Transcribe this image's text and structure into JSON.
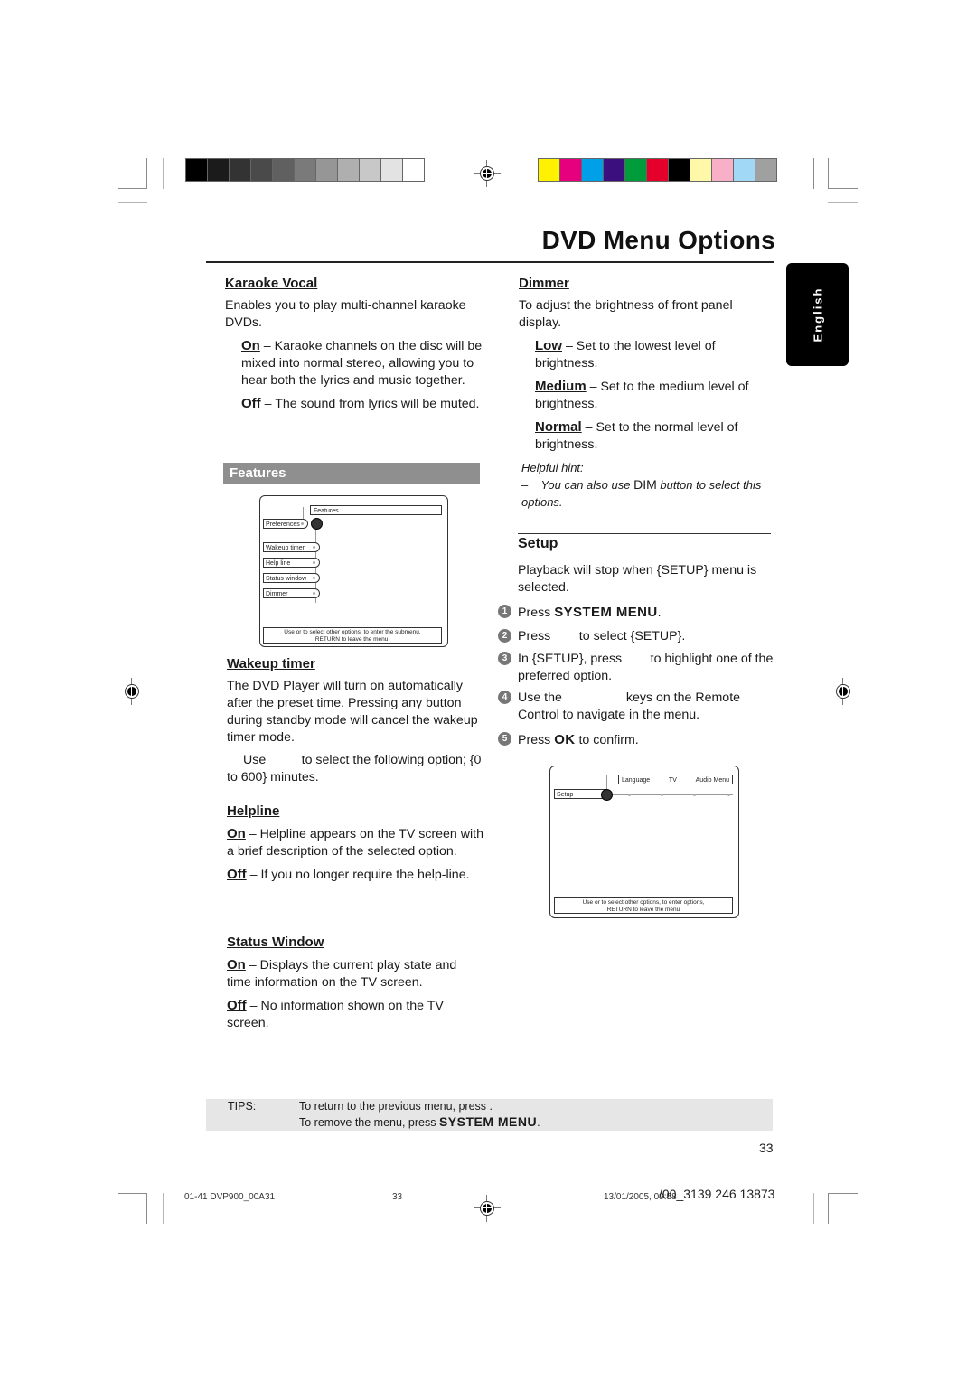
{
  "header": {
    "title": "DVD Menu Options",
    "language_tab": "English"
  },
  "print_marks": {
    "grayscale_swatches": [
      "#000000",
      "#1b1b1b",
      "#333333",
      "#4a4a4a",
      "#606060",
      "#7a7a7a",
      "#969696",
      "#afafaf",
      "#c8c8c8",
      "#e3e3e3",
      "#ffffff"
    ],
    "color_swatches": [
      "#fff200",
      "#e6007e",
      "#00a0e9",
      "#3b0f7e",
      "#009b3a",
      "#e4002b",
      "#000000",
      "#fff8a8",
      "#f8b0c8",
      "#a0d8f5",
      "#a0a0a0"
    ]
  },
  "left_column": {
    "karaoke": {
      "heading": "Karaoke Vocal",
      "intro": "Enables you to play multi-channel karaoke DVDs.",
      "on_label": "On",
      "on_text": " – Karaoke channels on the disc will be mixed into normal stereo, allowing you to hear both the lyrics and music together.",
      "off_label": "Off",
      "off_text": " – The sound from lyrics will be muted."
    },
    "features_bar": "Features",
    "features_menu": {
      "header": "Features",
      "parent": "Preferences",
      "items": [
        "Wakeup timer",
        "Help line",
        "Status window",
        "Dimmer"
      ],
      "footer_line1": "Use    or    to select other options, to enter the submenu,",
      "footer_line2": "RETURN to leave the menu."
    },
    "wakeup": {
      "heading": "Wakeup timer",
      "intro": "The DVD Player will turn on automatically after the preset time. Pressing any button during standby mode will cancel the wakeup timer mode.",
      "use_text": "Use          to select the following option; {0 to 600} minutes."
    },
    "helpline": {
      "heading": "Helpline",
      "on_label": "On",
      "on_text": " – Helpline appears on the TV screen with a brief description of the selected option.",
      "off_label": "Off",
      "off_text": " – If you no longer require the help-line."
    },
    "status_window": {
      "heading": "Status Window",
      "on_label": "On",
      "on_text": " – Displays the current play state and time information on the TV screen.",
      "off_label": "Off",
      "off_text": " – No information shown on the TV screen."
    }
  },
  "right_column": {
    "dimmer": {
      "heading": "Dimmer",
      "intro": "To adjust the brightness of front panel display.",
      "low_label": "Low",
      "low_text": " – Set to the lowest level of brightness.",
      "medium_label": "Medium",
      "medium_text": " – Set to the medium level of brightness.",
      "normal_label": "Normal",
      "normal_text": " – Set to the normal level of brightness.",
      "hint_title": "Helpful hint:",
      "hint_prefix": "–    You can also use ",
      "hint_key": "DIM",
      "hint_suffix": "  button to select this options."
    },
    "setup": {
      "heading": "Setup",
      "intro": "Playback will stop when {SETUP} menu is selected.",
      "steps": [
        {
          "num": "1",
          "pre": "Press ",
          "bold": "SYSTEM MENU",
          "post": "."
        },
        {
          "num": "2",
          "pre": "Press        to select {SETUP}.",
          "bold": "",
          "post": ""
        },
        {
          "num": "3",
          "pre": "In {SETUP}, press        to highlight one of the preferred option.",
          "bold": "",
          "post": ""
        },
        {
          "num": "4",
          "pre": "Use the                  keys on the Remote Control to navigate in the menu.",
          "bold": "",
          "post": ""
        },
        {
          "num": "5",
          "pre": "Press ",
          "bold": "OK",
          "post": " to confirm."
        }
      ],
      "menu": {
        "tabs": [
          "Language",
          "TV",
          "Audio Menu"
        ],
        "parent": "Setup",
        "footer_line1": "Use    or    to select other options,  to enter options,",
        "footer_line2": "RETURN to leave the menu"
      }
    }
  },
  "tips": {
    "label": "TIPS:",
    "line1": "To return to the previous menu, press   .",
    "line2_pre": "To remove the menu, press ",
    "line2_bold": "SYSTEM MENU",
    "line2_post": "."
  },
  "page_number": "33",
  "footer": {
    "file": "01-41 DVP900_00A31",
    "page": "33",
    "date": "13/01/2005, 09:58",
    "code": "/00_3139 246 13873"
  }
}
